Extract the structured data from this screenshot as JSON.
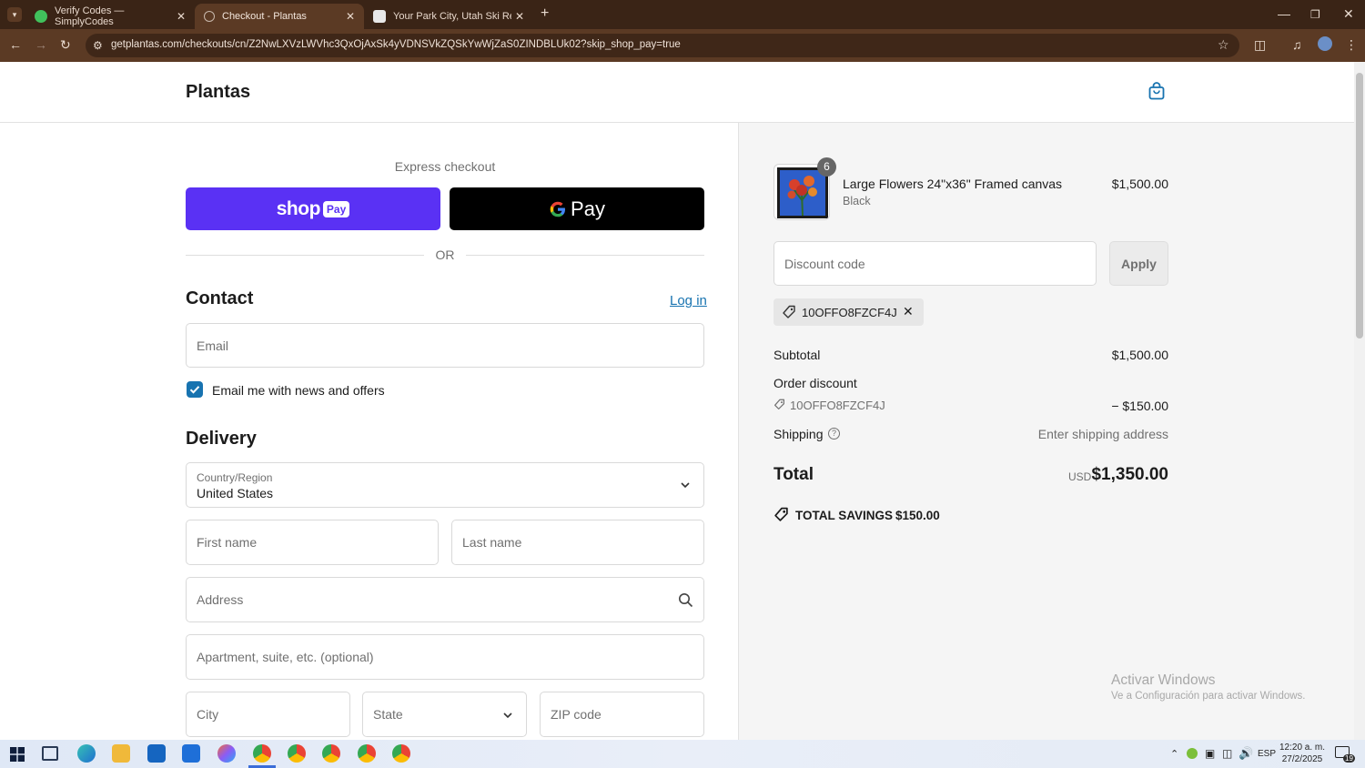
{
  "browser": {
    "tabs": [
      {
        "title": "Verify Codes — SimplyCodes",
        "active": false,
        "icon": "simplycodes-icon"
      },
      {
        "title": "Checkout - Plantas",
        "active": true,
        "icon": "globe-icon"
      },
      {
        "title": "Your Park City, Utah Ski Resort |",
        "active": false,
        "icon": "vail-icon"
      }
    ],
    "url": "getplantas.com/checkouts/cn/Z2NwLXVzLWVhc3QxOjAxSk4yVDNSVkZQSkYwWjZaS0ZINDBLUk02?skip_shop_pay=true"
  },
  "store": {
    "name": "Plantas"
  },
  "express": {
    "heading": "Express checkout",
    "shop_pay_text": "shop",
    "shop_pay_badge": "Pay",
    "gpay_text": "Pay",
    "or_label": "OR"
  },
  "contact": {
    "heading": "Contact",
    "login_link": "Log in",
    "email_placeholder": "Email",
    "newsletter_label": "Email me with news and offers",
    "newsletter_checked": true
  },
  "delivery": {
    "heading": "Delivery",
    "country_label": "Country/Region",
    "country_value": "United States",
    "first_name": "First name",
    "last_name": "Last name",
    "address": "Address",
    "apartment": "Apartment, suite, etc. (optional)",
    "city": "City",
    "state": "State",
    "zip": "ZIP code"
  },
  "summary": {
    "item": {
      "name": "Large Flowers 24\"x36\" Framed canvas",
      "variant": "Black",
      "price": "$1,500.00",
      "quantity": "6"
    },
    "discount_placeholder": "Discount code",
    "apply_label": "Apply",
    "applied_code": "10OFFO8FZCF4J",
    "subtotal_label": "Subtotal",
    "subtotal_value": "$1,500.00",
    "order_discount_label": "Order discount",
    "order_discount_code": "10OFFO8FZCF4J",
    "order_discount_value": "− $150.00",
    "shipping_label": "Shipping",
    "shipping_value": "Enter shipping address",
    "total_label": "Total",
    "currency": "USD",
    "total_value": "$1,350.00",
    "savings_label": "TOTAL SAVINGS",
    "savings_value": "$150.00"
  },
  "watermark": {
    "line1": "Activar Windows",
    "line2": "Ve a Configuración para activar Windows."
  },
  "taskbar": {
    "lang": "ESP",
    "time": "12:20 a. m.",
    "date": "27/2/2025",
    "notif_count": "19"
  },
  "colors": {
    "shop_pay": "#5a31f4",
    "accent": "#1773b0",
    "chrome_tabbar": "#3a2416",
    "chrome_toolbar": "#5b3a24"
  }
}
